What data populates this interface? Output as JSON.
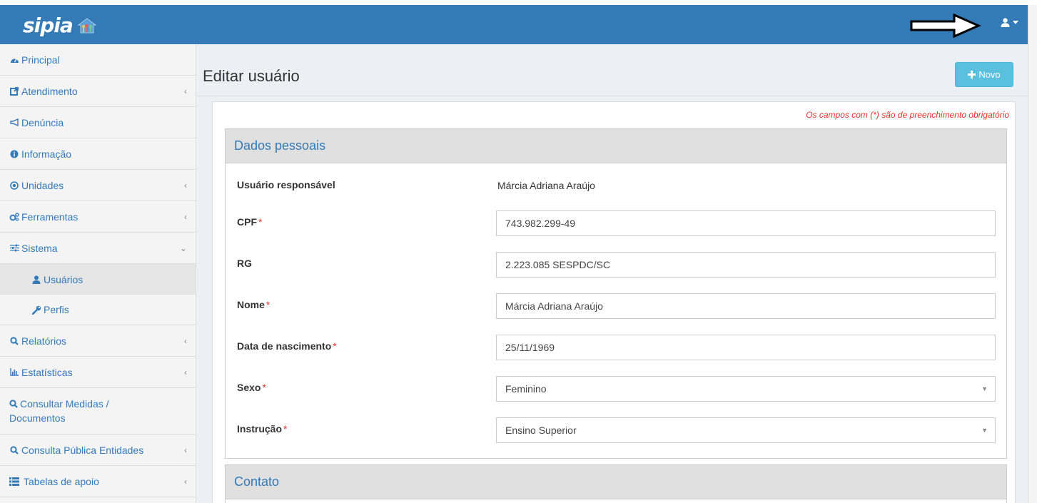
{
  "brand": {
    "name": "sipia"
  },
  "colors": {
    "primary": "#337ab7",
    "info": "#5bc0de",
    "required": "#e0342b"
  },
  "topbar": {
    "user_icon": "user-icon",
    "dropdown_icon": "caret-down-icon"
  },
  "sidebar": {
    "items": [
      {
        "label": "Principal",
        "icon": "dashboard-icon"
      },
      {
        "label": "Atendimento",
        "icon": "share-square-icon",
        "expandable": true
      },
      {
        "label": "Denúncia",
        "icon": "bullhorn-icon"
      },
      {
        "label": "Informação",
        "icon": "info-circle-icon"
      },
      {
        "label": "Unidades",
        "icon": "dot-circle-icon",
        "expandable": true
      },
      {
        "label": "Ferramentas",
        "icon": "cogs-icon",
        "expandable": true
      },
      {
        "label": "Sistema",
        "icon": "sliders-icon",
        "expanded": true
      },
      {
        "label": "Usuários",
        "icon": "user-icon",
        "sub": true,
        "active": true
      },
      {
        "label": "Perfis",
        "icon": "wrench-icon",
        "sub": true
      },
      {
        "label": "Relatórios",
        "icon": "search-icon",
        "expandable": true
      },
      {
        "label": "Estatísticas",
        "icon": "bar-chart-icon",
        "expandable": true
      },
      {
        "label": "Consultar Medidas / Documentos",
        "icon": "search-icon"
      },
      {
        "label": "Consulta Pública Entidades",
        "icon": "search-icon",
        "expandable": true
      },
      {
        "label": "Tabelas de apoio",
        "icon": "list-icon",
        "expandable": true
      }
    ]
  },
  "page": {
    "title": "Editar usuário",
    "new_button": "Novo",
    "required_note": "Os campos com (*) são de preenchimento obrigatório"
  },
  "form": {
    "section_personal": "Dados pessoais",
    "section_contact": "Contato",
    "responsible_label": "Usuário responsável",
    "responsible_value": "Márcia Adriana Araújo",
    "required_mark": "*",
    "fields": {
      "cpf": {
        "label": "CPF",
        "value": "743.982.299-49"
      },
      "rg": {
        "label": "RG",
        "value": "2.223.085 SESPDC/SC"
      },
      "nome": {
        "label": "Nome",
        "value": "Márcia Adriana Araújo"
      },
      "nascimento": {
        "label": "Data de nascimento",
        "value": "25/11/1969"
      },
      "sexo": {
        "label": "Sexo",
        "value": "Feminino"
      },
      "instrucao": {
        "label": "Instrução",
        "value": "Ensino Superior"
      }
    }
  }
}
